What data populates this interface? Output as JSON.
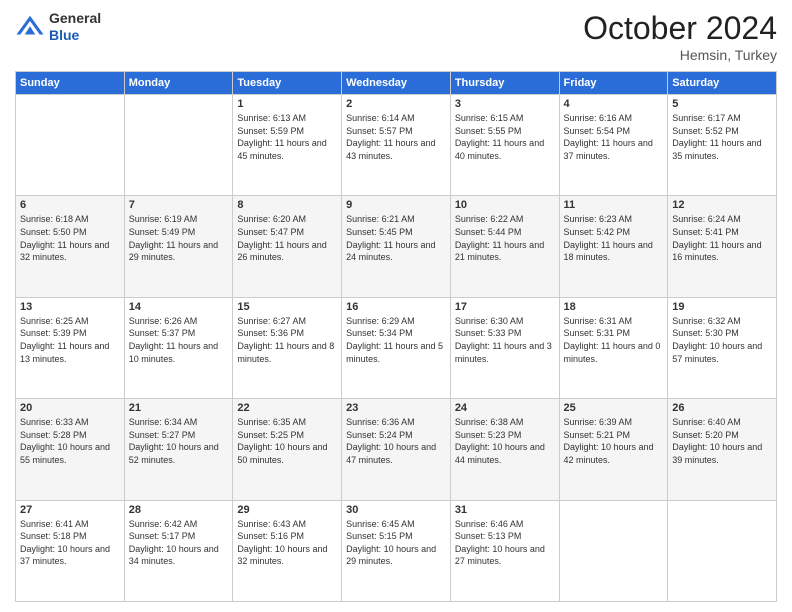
{
  "logo": {
    "general": "General",
    "blue": "Blue"
  },
  "header": {
    "month": "October 2024",
    "location": "Hemsin, Turkey"
  },
  "days_of_week": [
    "Sunday",
    "Monday",
    "Tuesday",
    "Wednesday",
    "Thursday",
    "Friday",
    "Saturday"
  ],
  "weeks": [
    [
      null,
      null,
      {
        "day": 1,
        "sunrise": "6:13 AM",
        "sunset": "5:59 PM",
        "daylight": "11 hours and 45 minutes."
      },
      {
        "day": 2,
        "sunrise": "6:14 AM",
        "sunset": "5:57 PM",
        "daylight": "11 hours and 43 minutes."
      },
      {
        "day": 3,
        "sunrise": "6:15 AM",
        "sunset": "5:55 PM",
        "daylight": "11 hours and 40 minutes."
      },
      {
        "day": 4,
        "sunrise": "6:16 AM",
        "sunset": "5:54 PM",
        "daylight": "11 hours and 37 minutes."
      },
      {
        "day": 5,
        "sunrise": "6:17 AM",
        "sunset": "5:52 PM",
        "daylight": "11 hours and 35 minutes."
      }
    ],
    [
      {
        "day": 6,
        "sunrise": "6:18 AM",
        "sunset": "5:50 PM",
        "daylight": "11 hours and 32 minutes."
      },
      {
        "day": 7,
        "sunrise": "6:19 AM",
        "sunset": "5:49 PM",
        "daylight": "11 hours and 29 minutes."
      },
      {
        "day": 8,
        "sunrise": "6:20 AM",
        "sunset": "5:47 PM",
        "daylight": "11 hours and 26 minutes."
      },
      {
        "day": 9,
        "sunrise": "6:21 AM",
        "sunset": "5:45 PM",
        "daylight": "11 hours and 24 minutes."
      },
      {
        "day": 10,
        "sunrise": "6:22 AM",
        "sunset": "5:44 PM",
        "daylight": "11 hours and 21 minutes."
      },
      {
        "day": 11,
        "sunrise": "6:23 AM",
        "sunset": "5:42 PM",
        "daylight": "11 hours and 18 minutes."
      },
      {
        "day": 12,
        "sunrise": "6:24 AM",
        "sunset": "5:41 PM",
        "daylight": "11 hours and 16 minutes."
      }
    ],
    [
      {
        "day": 13,
        "sunrise": "6:25 AM",
        "sunset": "5:39 PM",
        "daylight": "11 hours and 13 minutes."
      },
      {
        "day": 14,
        "sunrise": "6:26 AM",
        "sunset": "5:37 PM",
        "daylight": "11 hours and 10 minutes."
      },
      {
        "day": 15,
        "sunrise": "6:27 AM",
        "sunset": "5:36 PM",
        "daylight": "11 hours and 8 minutes."
      },
      {
        "day": 16,
        "sunrise": "6:29 AM",
        "sunset": "5:34 PM",
        "daylight": "11 hours and 5 minutes."
      },
      {
        "day": 17,
        "sunrise": "6:30 AM",
        "sunset": "5:33 PM",
        "daylight": "11 hours and 3 minutes."
      },
      {
        "day": 18,
        "sunrise": "6:31 AM",
        "sunset": "5:31 PM",
        "daylight": "11 hours and 0 minutes."
      },
      {
        "day": 19,
        "sunrise": "6:32 AM",
        "sunset": "5:30 PM",
        "daylight": "10 hours and 57 minutes."
      }
    ],
    [
      {
        "day": 20,
        "sunrise": "6:33 AM",
        "sunset": "5:28 PM",
        "daylight": "10 hours and 55 minutes."
      },
      {
        "day": 21,
        "sunrise": "6:34 AM",
        "sunset": "5:27 PM",
        "daylight": "10 hours and 52 minutes."
      },
      {
        "day": 22,
        "sunrise": "6:35 AM",
        "sunset": "5:25 PM",
        "daylight": "10 hours and 50 minutes."
      },
      {
        "day": 23,
        "sunrise": "6:36 AM",
        "sunset": "5:24 PM",
        "daylight": "10 hours and 47 minutes."
      },
      {
        "day": 24,
        "sunrise": "6:38 AM",
        "sunset": "5:23 PM",
        "daylight": "10 hours and 44 minutes."
      },
      {
        "day": 25,
        "sunrise": "6:39 AM",
        "sunset": "5:21 PM",
        "daylight": "10 hours and 42 minutes."
      },
      {
        "day": 26,
        "sunrise": "6:40 AM",
        "sunset": "5:20 PM",
        "daylight": "10 hours and 39 minutes."
      }
    ],
    [
      {
        "day": 27,
        "sunrise": "6:41 AM",
        "sunset": "5:18 PM",
        "daylight": "10 hours and 37 minutes."
      },
      {
        "day": 28,
        "sunrise": "6:42 AM",
        "sunset": "5:17 PM",
        "daylight": "10 hours and 34 minutes."
      },
      {
        "day": 29,
        "sunrise": "6:43 AM",
        "sunset": "5:16 PM",
        "daylight": "10 hours and 32 minutes."
      },
      {
        "day": 30,
        "sunrise": "6:45 AM",
        "sunset": "5:15 PM",
        "daylight": "10 hours and 29 minutes."
      },
      {
        "day": 31,
        "sunrise": "6:46 AM",
        "sunset": "5:13 PM",
        "daylight": "10 hours and 27 minutes."
      },
      null,
      null
    ]
  ]
}
